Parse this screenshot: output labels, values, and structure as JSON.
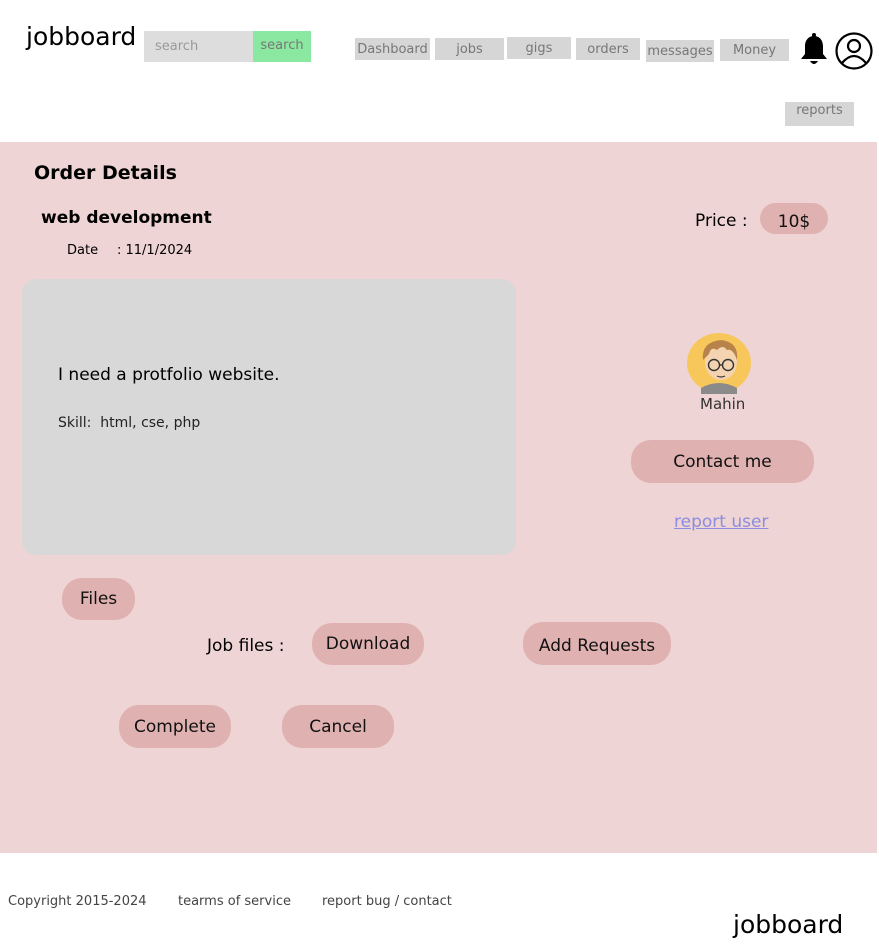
{
  "header": {
    "logo": "jobboard",
    "search_placeholder": "search",
    "search_button": "search",
    "nav": [
      "Dashboard",
      "jobs",
      "gigs",
      "orders",
      "messages",
      "Money",
      "reports"
    ]
  },
  "order": {
    "heading": "Order Details",
    "title": "web development",
    "date_label": "Date",
    "date_value": ": 11/1/2024",
    "price_label": "Price :",
    "price_value": "10$",
    "description": "I need a protfolio website.",
    "skills": "Skill:  html, cse, php"
  },
  "user": {
    "name": "Mahin",
    "contact_button": "Contact me",
    "report_link": "report user"
  },
  "files": {
    "files_button": "Files",
    "job_files_label": "Job files :",
    "download_button": "Download",
    "add_requests_button": "Add Requests"
  },
  "actions": {
    "complete_button": "Complete",
    "cancel_button": "Cancel"
  },
  "footer": {
    "copyright": "Copyright 2015-2024",
    "terms": "tearms of service",
    "report": "report bug / contact",
    "logo": "jobboard"
  },
  "colors": {
    "main_bg": "#eed4d4",
    "pill": "#e0b1b1",
    "search_button": "#8ae8a0",
    "link": "#8c8ce0"
  }
}
